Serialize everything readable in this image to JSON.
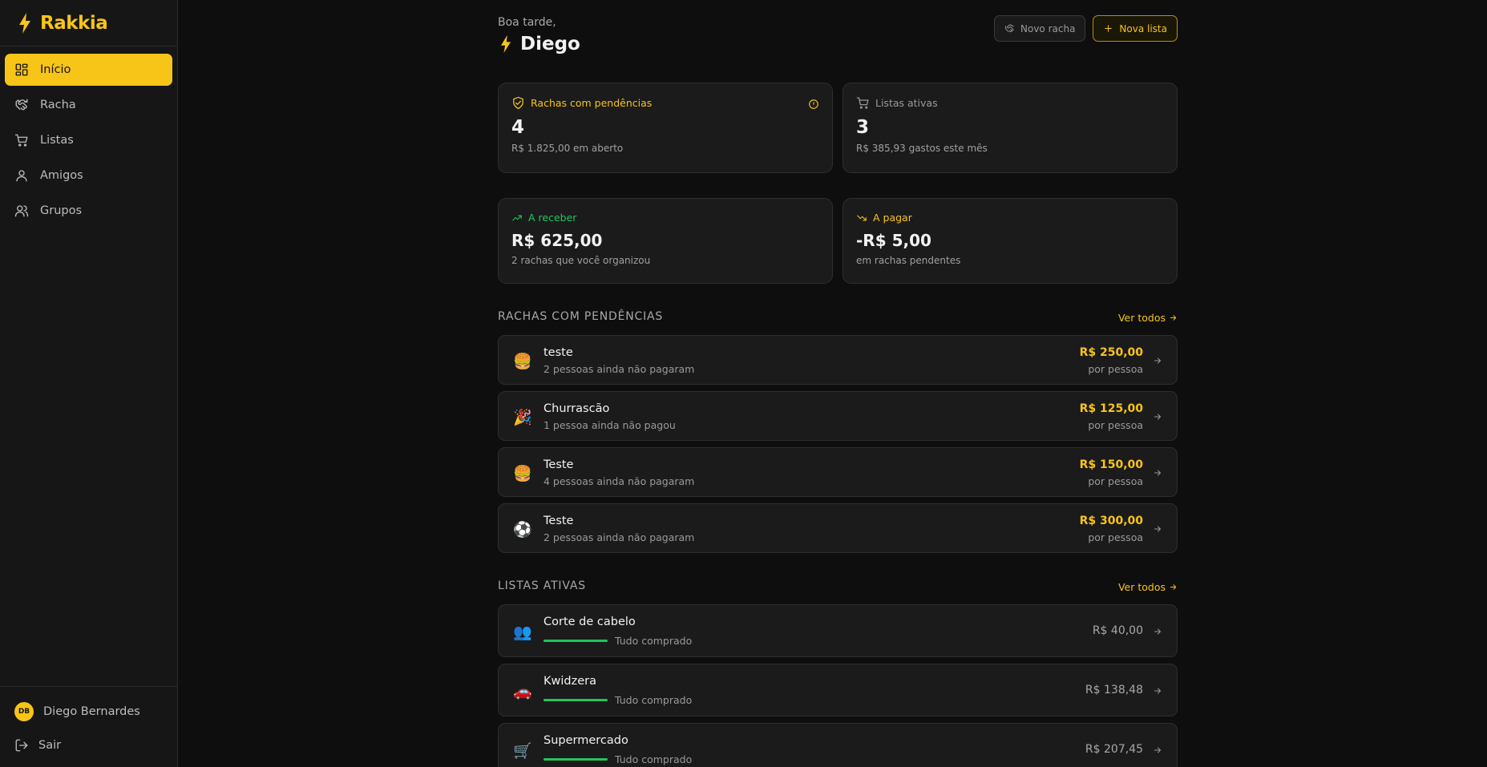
{
  "brand": {
    "name": "Rakkia",
    "icon": "bolt-icon"
  },
  "sidebar": {
    "items": [
      {
        "label": "Início",
        "icon": "dashboard-icon",
        "active": true
      },
      {
        "label": "Racha",
        "icon": "handshake-icon",
        "active": false
      },
      {
        "label": "Listas",
        "icon": "cart-icon",
        "active": false
      },
      {
        "label": "Amigos",
        "icon": "user-icon",
        "active": false
      },
      {
        "label": "Grupos",
        "icon": "users-icon",
        "active": false
      }
    ],
    "user": {
      "initials": "DB",
      "name": "Diego Bernardes"
    },
    "logout_label": "Sair"
  },
  "header": {
    "greeting": "Boa tarde,",
    "user_name": "Diego",
    "btn_new_split": "Novo racha",
    "btn_new_list": "Nova lista"
  },
  "stats": {
    "pending_splits": {
      "label": "Rachas com pendências",
      "value": "4",
      "sub": "R$ 1.825,00 em aberto"
    },
    "active_lists": {
      "label": "Listas ativas",
      "value": "3",
      "sub": "R$ 385,93 gastos este mês"
    },
    "to_receive": {
      "label": "A receber",
      "value": "R$ 625,00",
      "sub": "2 rachas que você organizou"
    },
    "to_pay": {
      "label": "A pagar",
      "value": "-R$ 5,00",
      "sub": "em rachas pendentes"
    }
  },
  "pending_section": {
    "title": "RACHAS COM PENDÊNCIAS",
    "see_all": "Ver todos",
    "items": [
      {
        "emoji": "🍔",
        "title": "teste",
        "sub": "2 pessoas ainda não pagaram",
        "amount": "R$ 250,00",
        "per": "por pessoa"
      },
      {
        "emoji": "🎉",
        "title": "Churrascão",
        "sub": "1 pessoa ainda não pagou",
        "amount": "R$ 125,00",
        "per": "por pessoa"
      },
      {
        "emoji": "🍔",
        "title": "Teste",
        "sub": "4 pessoas ainda não pagaram",
        "amount": "R$ 150,00",
        "per": "por pessoa"
      },
      {
        "emoji": "⚽",
        "title": "Teste",
        "sub": "2 pessoas ainda não pagaram",
        "amount": "R$ 300,00",
        "per": "por pessoa"
      }
    ]
  },
  "lists_section": {
    "title": "LISTAS ATIVAS",
    "see_all": "Ver todos",
    "items": [
      {
        "emoji": "👥",
        "title": "Corte de cabelo",
        "status": "Tudo comprado",
        "progress": 1.0,
        "amount": "R$ 40,00"
      },
      {
        "emoji": "🚗",
        "title": "Kwidzera",
        "status": "Tudo comprado",
        "progress": 1.0,
        "amount": "R$ 138,48"
      },
      {
        "emoji": "🛒",
        "title": "Supermercado",
        "status": "Tudo comprado",
        "progress": 1.0,
        "amount": "R$ 207,45"
      }
    ]
  },
  "colors": {
    "accent": "#f7c418",
    "positive": "#22c55e",
    "background": "#0e0e0e",
    "card": "#1b1b1b"
  }
}
